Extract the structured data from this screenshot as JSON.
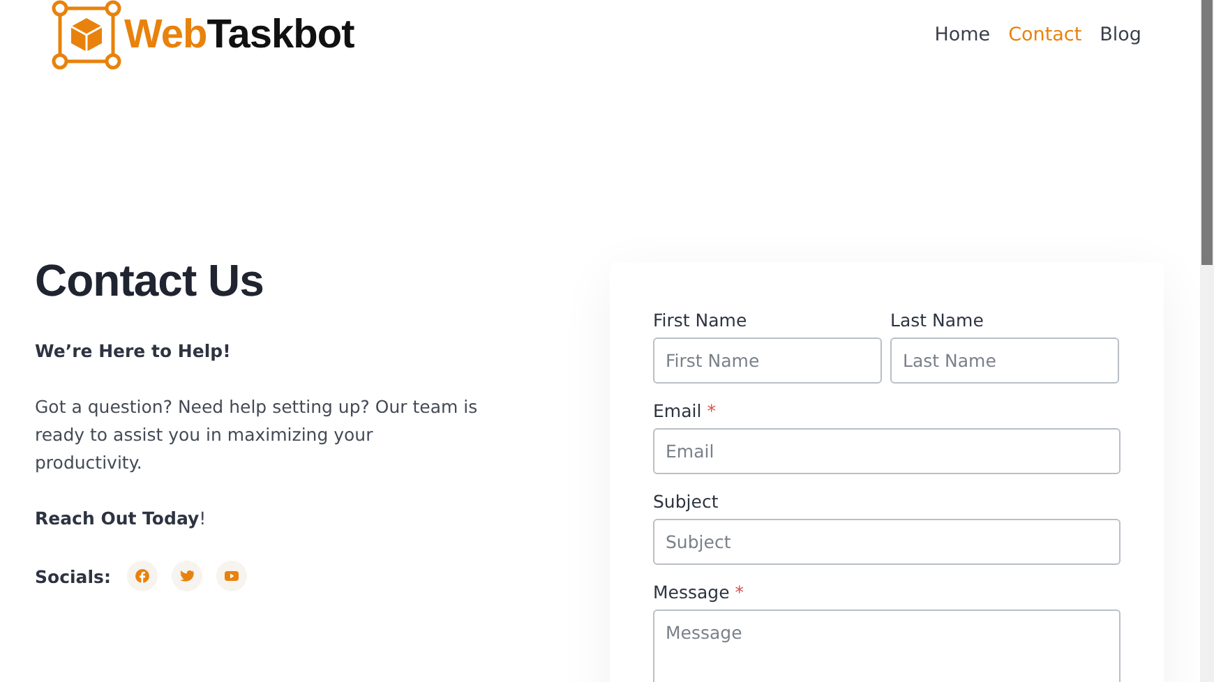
{
  "header": {
    "logo_text_parts": [
      "Web",
      "Taskbot"
    ],
    "nav": [
      {
        "label": "Home",
        "selected": false
      },
      {
        "label": "Contact",
        "selected": true
      },
      {
        "label": "Blog",
        "selected": false
      }
    ]
  },
  "intro": {
    "title": "Contact Us",
    "tagline": "We’re Here to Help!",
    "body": "Got a question? Need help setting up? Our team is ready to assist you in maximizing your productivity.",
    "call_to_action": "**Reach Out Today**!",
    "socials_label": "Socials:",
    "socials": [
      {
        "kind": "facebook"
      },
      {
        "kind": "twitter"
      },
      {
        "kind": "youtube"
      }
    ]
  },
  "form": {
    "required_mark": "*",
    "fields": [
      {
        "kind": "half",
        "label": "First Name",
        "placeholder": "First Name",
        "required": false
      },
      {
        "kind": "half",
        "label": "Last Name",
        "placeholder": "Last Name",
        "required": false
      },
      {
        "kind": "full",
        "label": "Email",
        "placeholder": "Email",
        "required": true
      },
      {
        "kind": "full",
        "label": "Subject",
        "placeholder": "Subject",
        "required": false
      },
      {
        "kind": "multiline",
        "label": "Message",
        "placeholder": "Message",
        "required": true
      }
    ]
  }
}
